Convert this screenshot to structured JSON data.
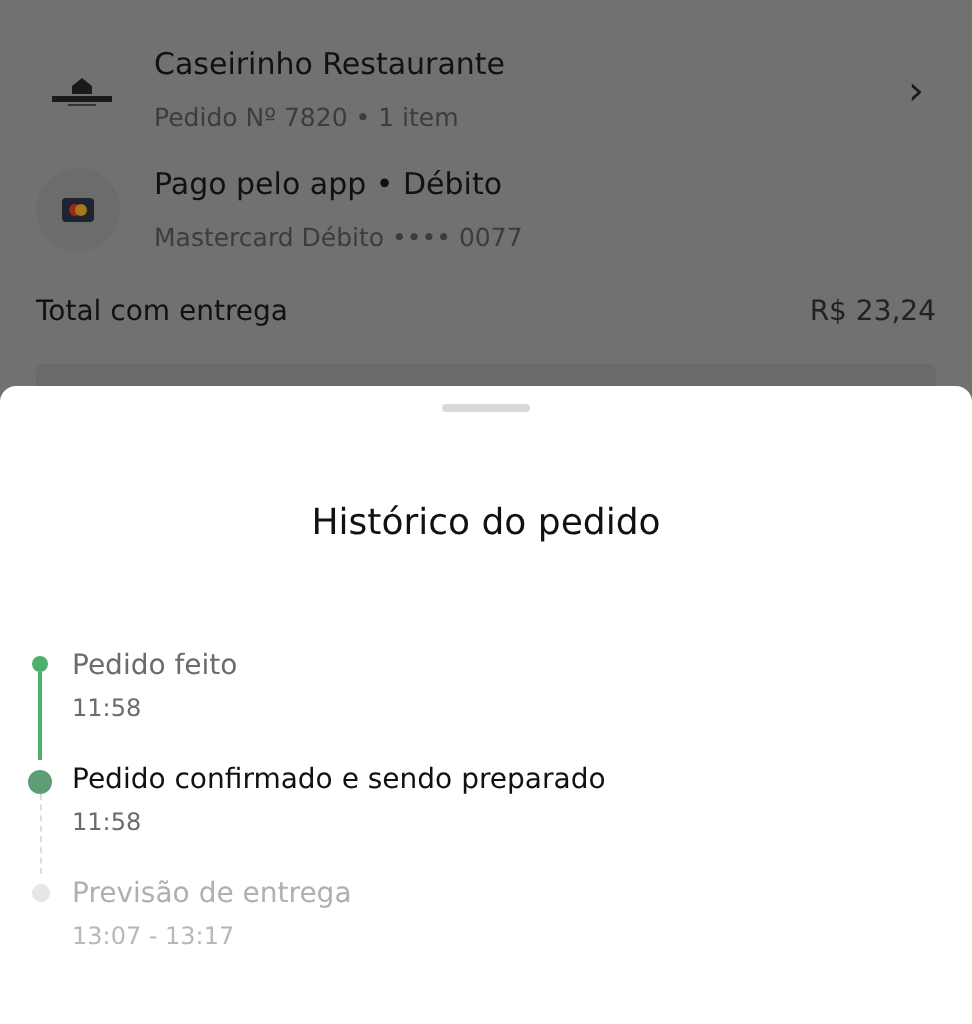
{
  "order": {
    "restaurant": {
      "name": "Caseirinho Restaurante",
      "details": "Pedido Nº 7820 • 1 item",
      "chevron": "›"
    },
    "payment": {
      "title": "Pago pelo app • Débito",
      "details": "Mastercard Débito •••• 0077"
    },
    "total": {
      "label": "Total com entrega",
      "value": "R$ 23,24"
    }
  },
  "sheet": {
    "title": "Histórico do pedido",
    "steps": [
      {
        "kind": "done",
        "label": "Pedido feito",
        "time": "11:58"
      },
      {
        "kind": "current",
        "label": "Pedido confirmado e sendo preparado",
        "time": "11:58"
      },
      {
        "kind": "pending",
        "label": "Previsão de entrega",
        "time": "13:07 - 13:17"
      }
    ]
  }
}
